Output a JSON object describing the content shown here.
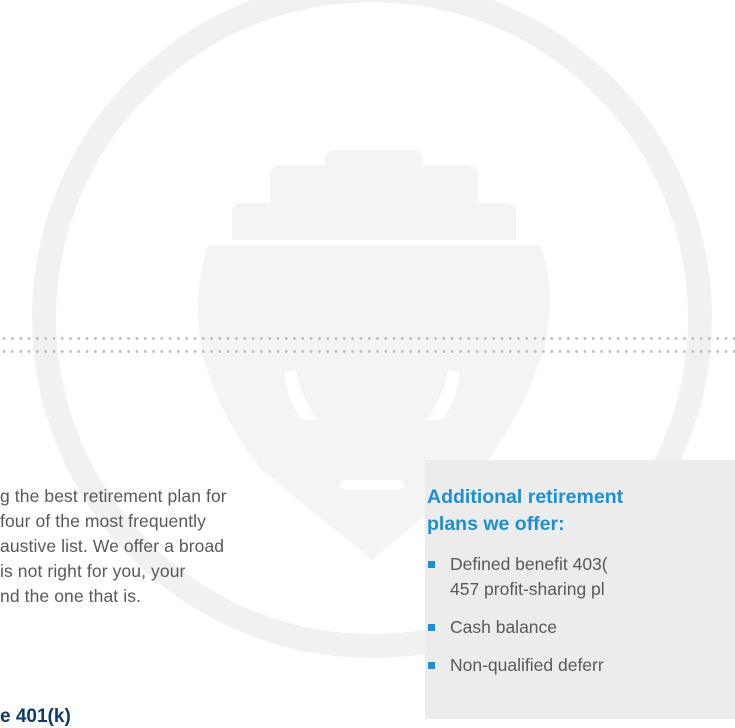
{
  "intro": {
    "lines": [
      "g the best retirement plan for",
      "four of the most frequently",
      "austive list. We offer a broad",
      " is not right for you, your",
      "nd the one that is."
    ]
  },
  "section_heading": "e 401(k)",
  "sidebar": {
    "heading_line1": "Additional retirement",
    "heading_line2": "plans we offer:",
    "items": [
      {
        "line1": "Defined benefit 403(",
        "line2": "457 profit-sharing pl"
      },
      {
        "line1": "Cash balance"
      },
      {
        "line1": "Non-qualified deferr"
      }
    ]
  },
  "colors": {
    "accent_blue": "#1e8fd0",
    "navy": "#0e3a6b",
    "body_gray": "#58595b",
    "panel_gray": "#ececec"
  },
  "icons": {
    "watermark": "ship-icon",
    "bullet": "square-bullet-icon"
  }
}
